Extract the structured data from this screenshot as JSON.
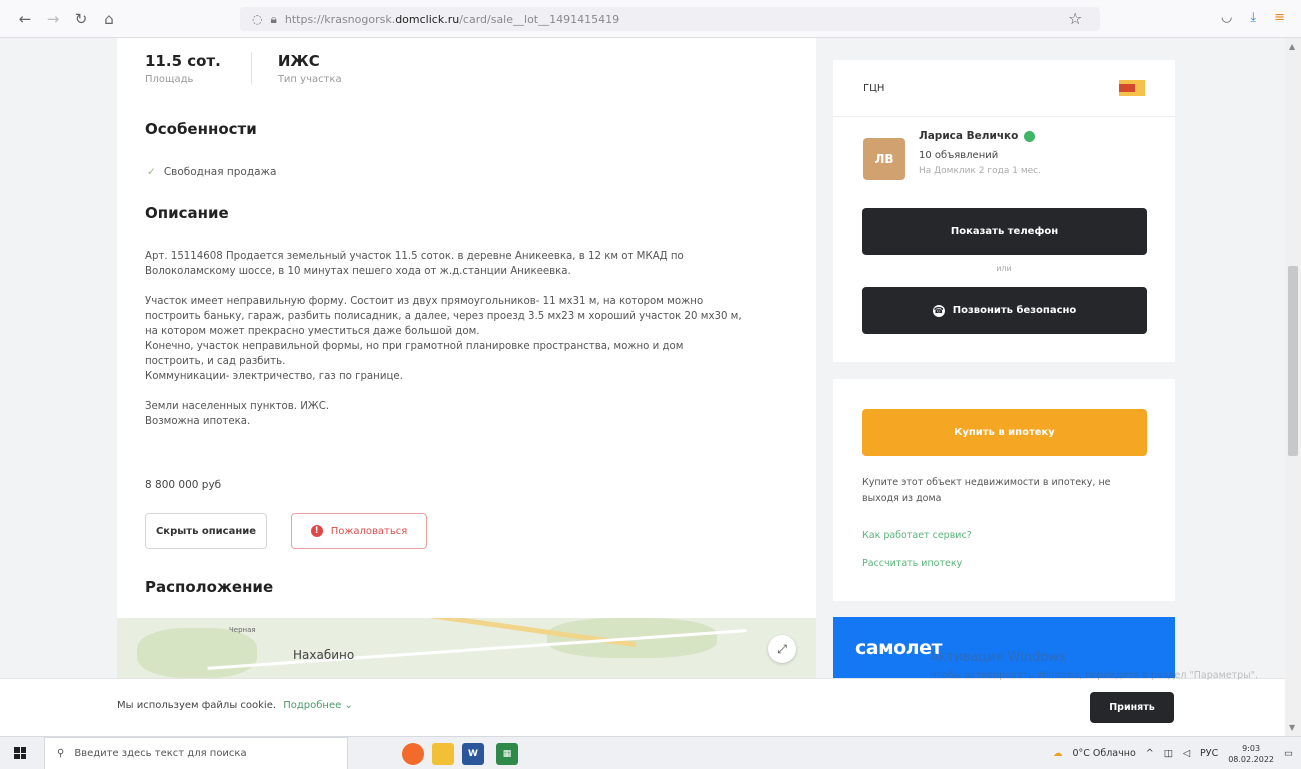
{
  "browser": {
    "url_prefix": "https://krasnogorsk.",
    "url_domain": "domclick.ru",
    "url_suffix": "/card/sale__lot__1491415419"
  },
  "params": [
    {
      "value": "11.5 сот.",
      "label": "Площадь"
    },
    {
      "value": "ИЖС",
      "label": "Тип участка"
    }
  ],
  "features": {
    "title": "Особенности",
    "items": [
      "Свободная продажа"
    ]
  },
  "description": {
    "title": "Описание",
    "paragraphs": [
      "Арт. 15114608 Продается земельный участок 11.5 соток. в деревне Аникеевка, в 12 км от МКАД по\nВолоколамскому шоссе, в 10 минутах пешего хода от ж.д.станции Аникеевка.",
      "Участок имеет неправильную форму. Состоит из двух прямоугольников- 11 мх31 м, на котором можно\nпостроить баньку, гараж, разбить полисадник, а далее, через проезд 3.5 мх23 м хороший участок 20 мх30 м,\nна котором может прекрасно уместиться даже большой дом.\nКонечно, участок неправильной формы, но при грамотной планировке пространства, можно и дом\nпостроить, и сад разбить.\nКоммуникации- электричество, газ по границе.",
      "Земли населенных пунктов. ИЖС.\nВозможна ипотека."
    ],
    "price": "8 800 000 руб",
    "hide_button": "Скрыть описание",
    "complain_button": "Пожаловаться"
  },
  "location": {
    "title": "Расположение",
    "map_label": "Нахабино",
    "map_small_label": "Черная"
  },
  "agent": {
    "agency": "ГЦН",
    "initials": "ЛВ",
    "name": "Лариса Величко",
    "listings": "10 объявлений",
    "since": "На Домклик 2 года 1 мес.",
    "show_phone": "Показать телефон",
    "or": "или",
    "call_safe": "Позвонить безопасно"
  },
  "mortgage": {
    "button": "Купить в ипотеку",
    "text": "Купите этот объект недвижимости в ипотеку, не выходя из дома",
    "link1": "Как работает сервис?",
    "link2": "Рассчитать ипотеку"
  },
  "ad": {
    "brand": "самолет"
  },
  "cookie": {
    "text": "Мы используем файлы cookie.",
    "more": "Подробнее",
    "accept": "Принять"
  },
  "watermark": {
    "title": "Активация Windows",
    "sub": "Чтобы активировать Windows, перейдите в раздел \"Параметры\"."
  },
  "taskbar": {
    "search_placeholder": "Введите здесь текст для поиска",
    "weather": "0°C Облачно",
    "lang": "РУС",
    "time": "9:03",
    "date": "08.02.2022"
  }
}
